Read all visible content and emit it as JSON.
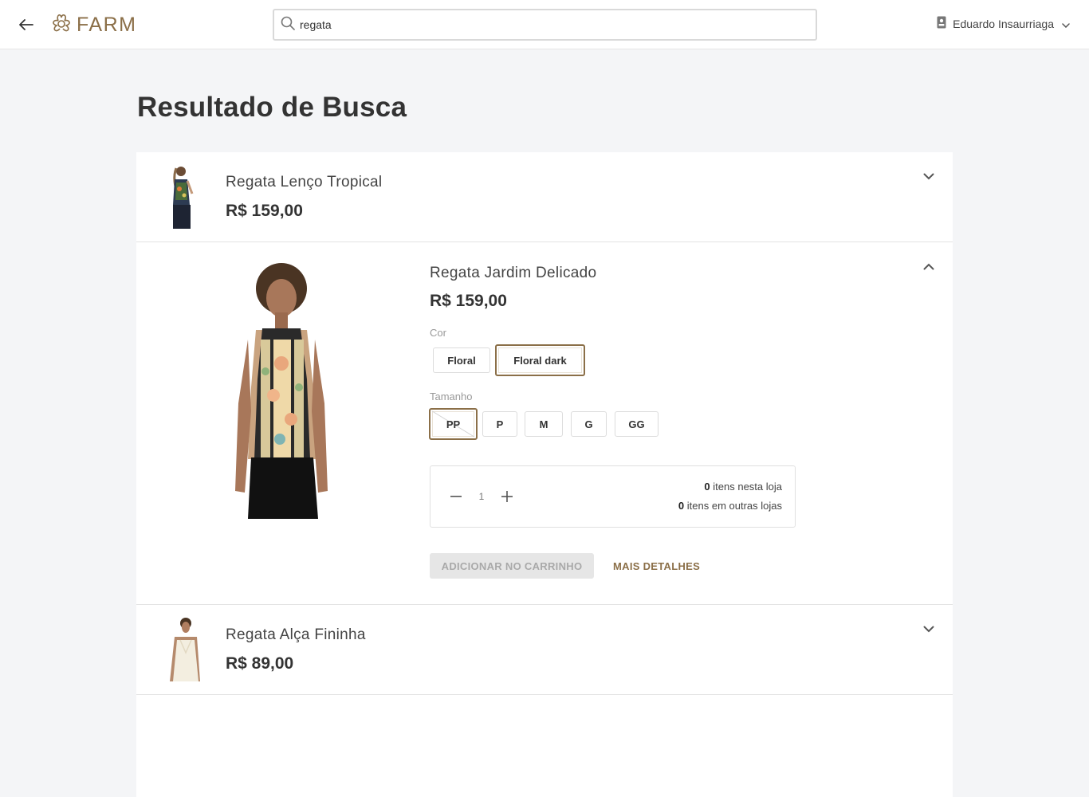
{
  "header": {
    "back_icon": "arrow-left-icon",
    "logo_icon": "flower-logo-icon",
    "logo_text": "FARM",
    "search_value": "regata",
    "search_icon": "search-icon",
    "user_icon": "id-badge-icon",
    "user_name": "Eduardo Insaurriaga",
    "user_chevron": "chevron-down-icon"
  },
  "page_title": "Resultado de Busca",
  "colors": {
    "accent": "#8b6f48",
    "text": "#333333",
    "background": "#f4f5f7"
  },
  "products": [
    {
      "name": "Regata Lenço Tropical",
      "price": "R$ 159,00",
      "expanded": false
    },
    {
      "name": "Regata Jardim Delicado",
      "price": "R$ 159,00",
      "expanded": true,
      "color_label": "Cor",
      "colors": [
        "Floral",
        "Floral dark"
      ],
      "selected_color": "Floral dark",
      "size_label": "Tamanho",
      "sizes": [
        "PP",
        "P",
        "M",
        "G",
        "GG"
      ],
      "selected_size": "PP",
      "quantity": "1",
      "stock_store_count": "0",
      "stock_store_text": "itens nesta loja",
      "stock_other_count": "0",
      "stock_other_text": "itens em outras lojas",
      "add_to_cart_label": "ADICIONAR NO CARRINHO",
      "more_details_label": "MAIS DETALHES"
    },
    {
      "name": "Regata Alça Fininha",
      "price": "R$ 89,00",
      "expanded": false
    }
  ]
}
